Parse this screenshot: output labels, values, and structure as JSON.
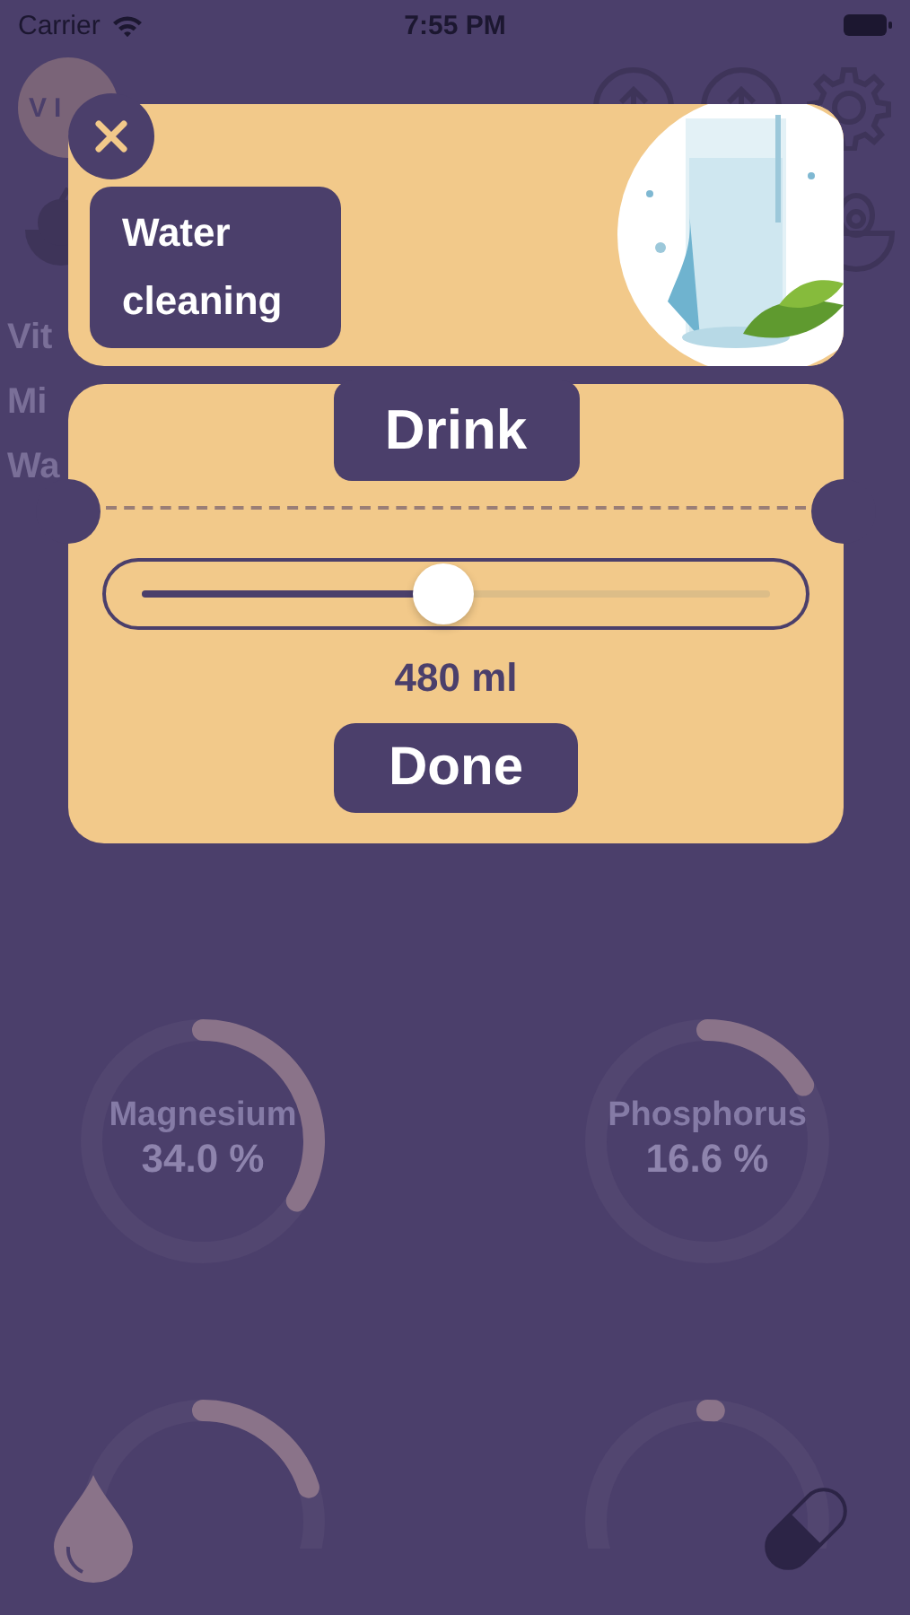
{
  "status_bar": {
    "carrier": "Carrier",
    "time": "7:55 PM"
  },
  "header": {
    "logo": "VI"
  },
  "nutrients": [
    {
      "label": "Vit"
    },
    {
      "label": "Mi"
    },
    {
      "label": "Wa"
    }
  ],
  "gauges": [
    {
      "name": "Magnesium",
      "value": "34.0 %"
    },
    {
      "name": "Phosphorus",
      "value": "16.6 %"
    }
  ],
  "modal": {
    "title": "Water cleaning",
    "tab": "Drink",
    "slider": {
      "level": 0.48
    },
    "amount": "480 ml",
    "done": "Done"
  }
}
